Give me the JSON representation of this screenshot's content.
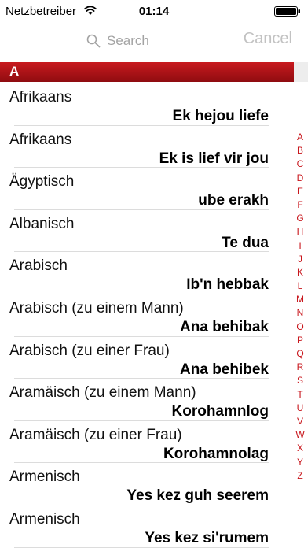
{
  "status": {
    "carrier": "Netzbetreiber",
    "time": "01:14"
  },
  "search": {
    "placeholder": "Search",
    "cancel_label": "Cancel"
  },
  "section": {
    "title": "A"
  },
  "colors": {
    "accent": "#c8161c",
    "header_gradient_top": "#c81a1f",
    "header_gradient_bottom": "#8f0c10"
  },
  "icons": {
    "search": "search-icon",
    "wifi": "wifi-icon",
    "battery": "battery-icon"
  },
  "rows": [
    {
      "language": "Afrikaans",
      "phrase": "Ek hejou liefe"
    },
    {
      "language": "Afrikaans",
      "phrase": "Ek is lief vir jou"
    },
    {
      "language": "Ägyptisch",
      "phrase": "ube erakh"
    },
    {
      "language": "Albanisch",
      "phrase": "Te dua"
    },
    {
      "language": "Arabisch",
      "phrase": "Ib'n hebbak"
    },
    {
      "language": "Arabisch (zu einem Mann)",
      "phrase": "Ana behibak"
    },
    {
      "language": "Arabisch (zu einer Frau)",
      "phrase": "Ana behibek"
    },
    {
      "language": "Aramäisch (zu einem Mann)",
      "phrase": "Korohamnlog"
    },
    {
      "language": "Aramäisch (zu einer Frau)",
      "phrase": "Korohamnolag"
    },
    {
      "language": "Armenisch",
      "phrase": "Yes kez guh seerem"
    },
    {
      "language": "Armenisch",
      "phrase": "Yes kez si'rumem"
    }
  ],
  "index": [
    "A",
    "B",
    "C",
    "D",
    "E",
    "F",
    "G",
    "H",
    "I",
    "J",
    "K",
    "L",
    "M",
    "N",
    "O",
    "P",
    "Q",
    "R",
    "S",
    "T",
    "U",
    "V",
    "W",
    "X",
    "Y",
    "Z"
  ]
}
